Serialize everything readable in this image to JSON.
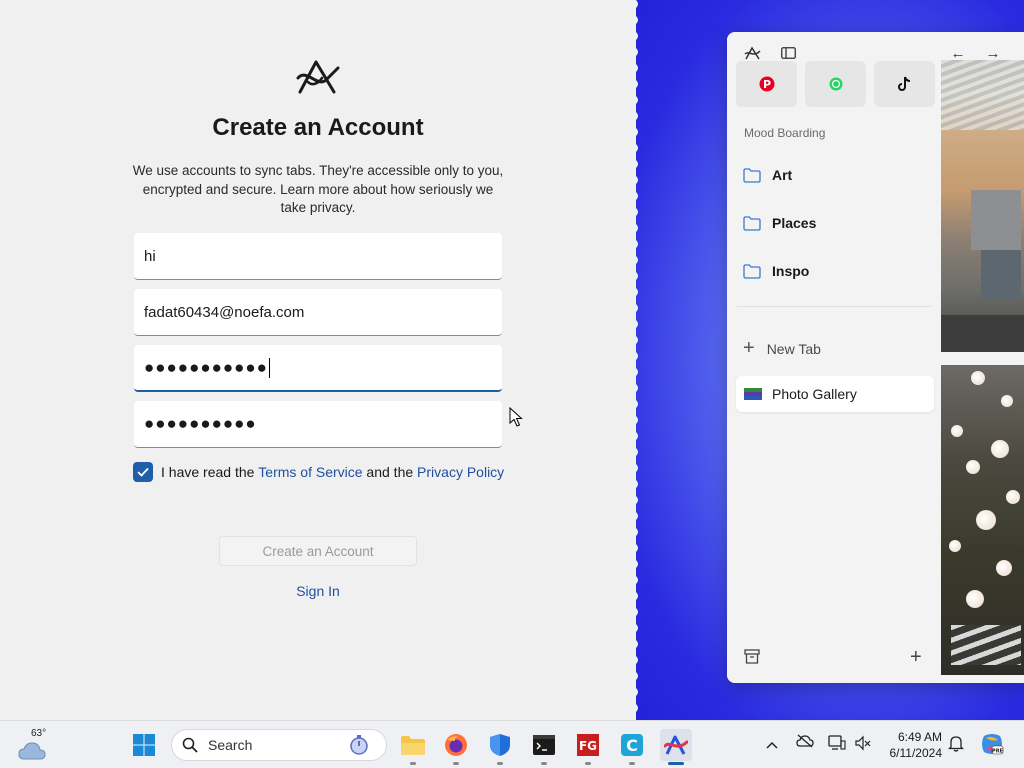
{
  "signup": {
    "title": "Create an Account",
    "description": "We use accounts to sync tabs. They're accessible only to you, encrypted and secure. Learn more about how seriously we take privacy.",
    "fields": [
      {
        "value": "hi"
      },
      {
        "value": "fadat60434@noefa.com"
      },
      {
        "value": "●●●●●●●●●●●"
      },
      {
        "value": "●●●●●●●●●●"
      }
    ],
    "terms_prefix": "I have read the ",
    "terms_link": "Terms of Service",
    "terms_mid": " and the ",
    "privacy_link": "Privacy Policy",
    "checkbox_checked": true,
    "create_button": "Create an Account",
    "signin_link": "Sign In"
  },
  "arc": {
    "favorites": [
      {
        "icon": "pinterest-icon",
        "color": "#e60023"
      },
      {
        "icon": "whatsapp-icon",
        "color": "#25d366"
      },
      {
        "icon": "tiktok-icon",
        "color": "#111111"
      }
    ],
    "section_label": "Mood Boarding",
    "folders": [
      {
        "label": "Art"
      },
      {
        "label": "Places"
      },
      {
        "label": "Inspo"
      }
    ],
    "new_tab": "New Tab",
    "active_tab": "Photo Gallery"
  },
  "taskbar": {
    "temperature": "63°",
    "search_label": "Search",
    "time": "6:49 AM",
    "date": "6/11/2024"
  },
  "colors": {
    "accent": "#1f5fa8",
    "link": "#1f4f9e",
    "desktop_blue": "#2a2be0"
  }
}
